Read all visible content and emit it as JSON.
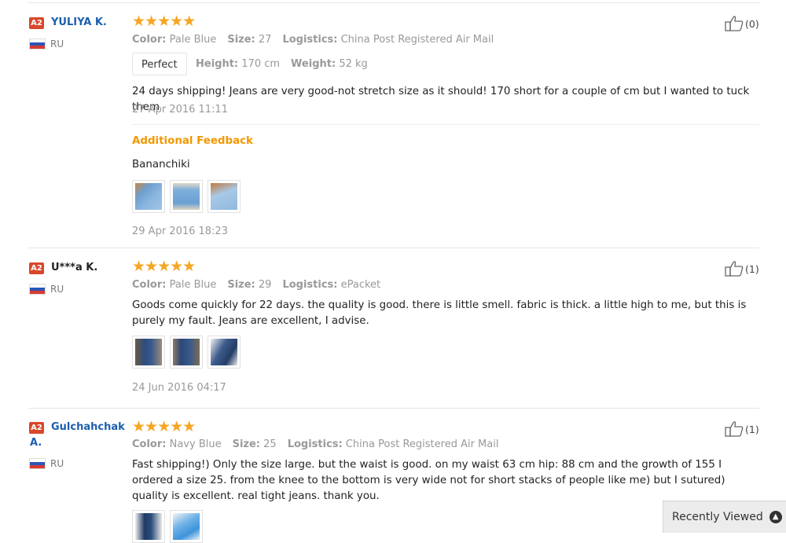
{
  "reviews": [
    {
      "badge": "A2",
      "user": "YULIYA K.",
      "country": "RU",
      "stars": "★★★★★",
      "color_label": "Color:",
      "color": "Pale Blue",
      "size_label": "Size:",
      "size": "27",
      "logistics_label": "Logistics:",
      "logistics": "China Post Registered Air Mail",
      "fit_tag": "Perfect",
      "height_label": "Height:",
      "height": "170 cm",
      "weight_label": "Weight:",
      "weight": "52 kg",
      "text": "24 days shipping! Jeans are very good-not stretch size as it should! 170 short for a couple of cm but I wanted to tuck them",
      "date": "27 Apr 2016 11:11",
      "additional_title": "Additional Feedback",
      "additional_text": "Bananchiki",
      "additional_date": "29 Apr 2016 18:23",
      "likes": "(0)"
    },
    {
      "badge": "A2",
      "user": "U***a K.",
      "country": "RU",
      "stars": "★★★★★",
      "color_label": "Color:",
      "color": "Pale Blue",
      "size_label": "Size:",
      "size": "29",
      "logistics_label": "Logistics:",
      "logistics": "ePacket",
      "text": "Goods come quickly for 22 days. the quality is good. there is little smell. fabric is thick. a little high to me, but this is purely my fault. Jeans are excellent, I advise.",
      "date": "24 Jun 2016 04:17",
      "likes": "(1)"
    },
    {
      "badge": "A2",
      "user_line1": "Gulchahchak",
      "user_line2": "A.",
      "country": "RU",
      "stars": "★★★★★",
      "color_label": "Color:",
      "color": "Navy Blue",
      "size_label": "Size:",
      "size": "25",
      "logistics_label": "Logistics:",
      "logistics": "China Post Registered Air Mail",
      "text": "Fast shipping!) Only the size large. but the waist is good. on my waist 63 cm hip: 88 cm and the growth of 155 I ordered a size 25. from the knee to the bottom is very wide not for short stacks of people like me) but I sutured) quality is excellent. real tight jeans. thank you.",
      "likes": "(1)"
    }
  ],
  "icons": {
    "like": "thumbs-up-icon",
    "flag": "russia-flag-icon",
    "recent_arrow": "chevron-up-icon"
  },
  "recently_viewed": "Recently Viewed",
  "colors": {
    "username": "#1c5fae",
    "stars": "#f5a623",
    "additional": "#f39800",
    "badge": "#d9472b"
  }
}
